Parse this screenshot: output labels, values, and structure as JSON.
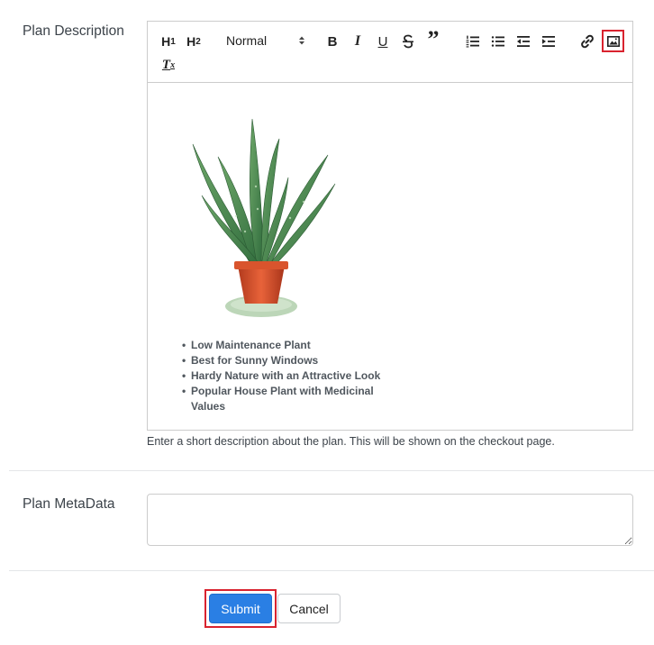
{
  "form": {
    "plan_description_label": "Plan Description",
    "plan_metadata_label": "Plan MetaData",
    "description_hint": "Enter a short description about the plan. This will be shown on the checkout page.",
    "metadata_value": ""
  },
  "toolbar": {
    "h1_label": "H",
    "h1_sub": "1",
    "h2_label": "H",
    "h2_sub": "2",
    "format_select": "Normal",
    "bold_label": "B",
    "italic_label": "I",
    "underline_label": "U",
    "quote_label": "”",
    "clear_label": "T",
    "clear_sub": "x"
  },
  "editor_content": {
    "bullets": [
      "Low Maintenance Plant",
      "Best for Sunny Windows",
      "Hardy Nature with an Attractive Look",
      "Popular House Plant with Medicinal Values"
    ]
  },
  "buttons": {
    "submit_label": "Submit",
    "cancel_label": "Cancel"
  },
  "colors": {
    "primary": "#2a7fe4",
    "highlight": "#d9232f"
  }
}
